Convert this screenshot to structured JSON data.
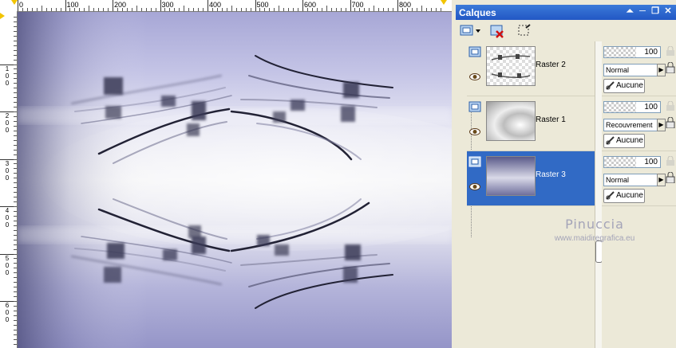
{
  "ruler": {
    "top_labels": [
      "0",
      "100",
      "200",
      "300",
      "400",
      "500",
      "600",
      "700",
      "800"
    ],
    "left_labels": [
      [
        "1",
        "0",
        "0"
      ],
      [
        "2",
        "0",
        "0"
      ],
      [
        "3",
        "0",
        "0"
      ],
      [
        "4",
        "0",
        "0"
      ],
      [
        "5",
        "0",
        "0"
      ],
      [
        "6",
        "0",
        "0"
      ]
    ]
  },
  "panel": {
    "title": "Calques",
    "controls": [
      "pin-icon",
      "close-icon"
    ]
  },
  "layers": [
    {
      "name": "Raster 2",
      "opacity": "100",
      "blend": "Normal",
      "group": "Aucune",
      "selected": false
    },
    {
      "name": "Raster 1",
      "opacity": "100",
      "blend": "Recouvrement",
      "group": "Aucune",
      "selected": false
    },
    {
      "name": "Raster 3",
      "opacity": "100",
      "blend": "Normal",
      "group": "Aucune",
      "selected": true
    }
  ],
  "watermark": {
    "line1": "Pinuccia",
    "line2": "www.maidiregrafica.eu"
  },
  "colors": {
    "selection": "#316ac5",
    "title_bar": "#2257c4",
    "panel_bg": "#ece9d8"
  }
}
